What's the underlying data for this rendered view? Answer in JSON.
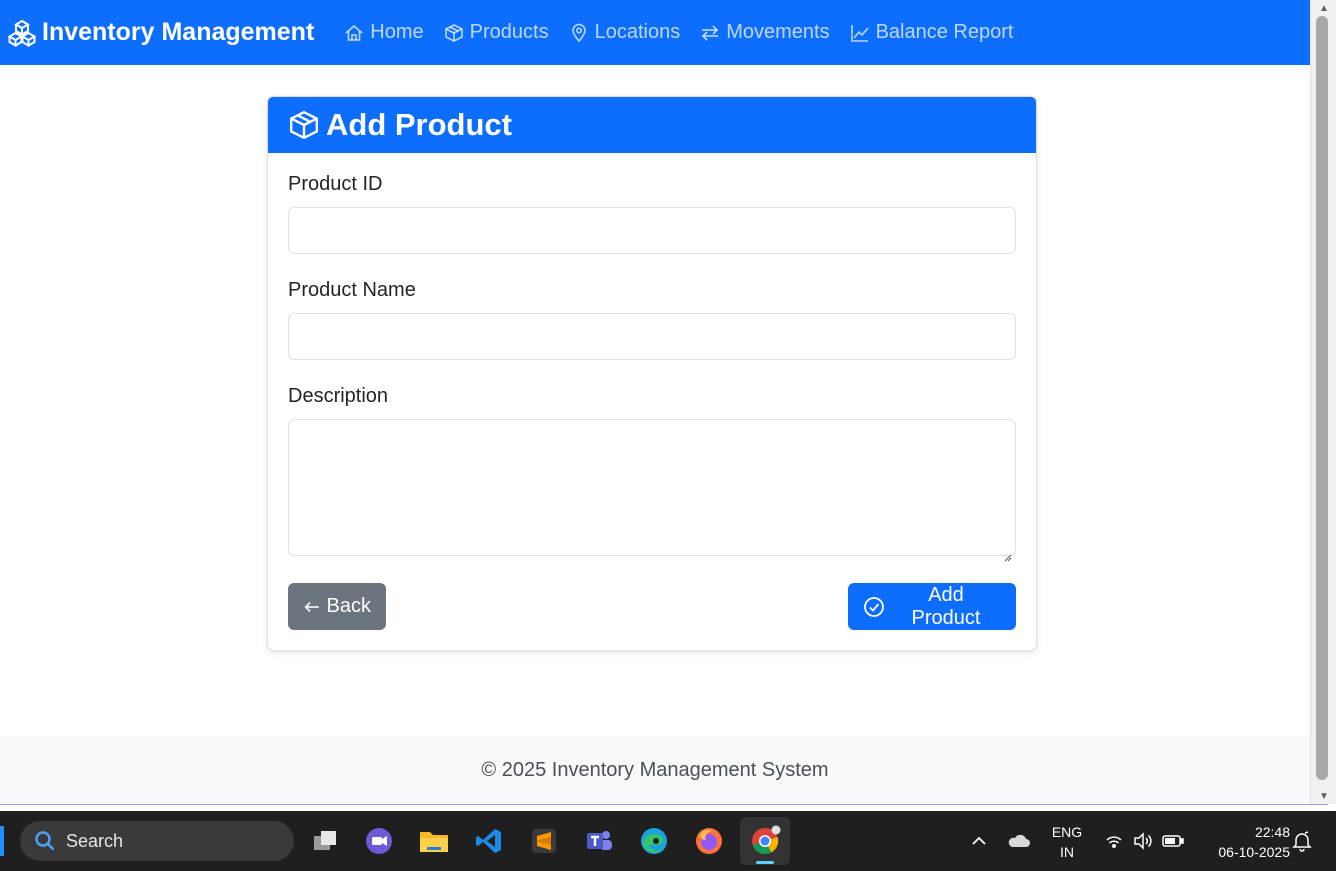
{
  "navbar": {
    "brand": "Inventory Management",
    "links": [
      {
        "label": "Home",
        "icon": "house-icon"
      },
      {
        "label": "Products",
        "icon": "box-icon"
      },
      {
        "label": "Locations",
        "icon": "map-pin-icon"
      },
      {
        "label": "Movements",
        "icon": "arrow-left-right-icon"
      },
      {
        "label": "Balance Report",
        "icon": "graph-up-icon"
      }
    ]
  },
  "card": {
    "title": "Add Product",
    "fields": {
      "product_id": {
        "label": "Product ID",
        "value": ""
      },
      "product_name": {
        "label": "Product Name",
        "value": ""
      },
      "description": {
        "label": "Description",
        "value": ""
      }
    },
    "back_label": "Back",
    "submit_label": "Add Product"
  },
  "footer": {
    "text": "© 2025 Inventory Management System"
  },
  "taskbar": {
    "search_placeholder": "Search",
    "language_top": "ENG",
    "language_bottom": "IN",
    "time": "22:48",
    "date": "06-10-2025",
    "apps": [
      "task-view",
      "meet",
      "file-explorer",
      "vscode",
      "sublime-text",
      "teams",
      "edge",
      "firefox",
      "chrome"
    ]
  },
  "colors": {
    "primary": "#0d6efd",
    "secondary": "#6c757d",
    "footer_bg": "#f8f9fa",
    "taskbar_bg": "#1f1f1f"
  }
}
